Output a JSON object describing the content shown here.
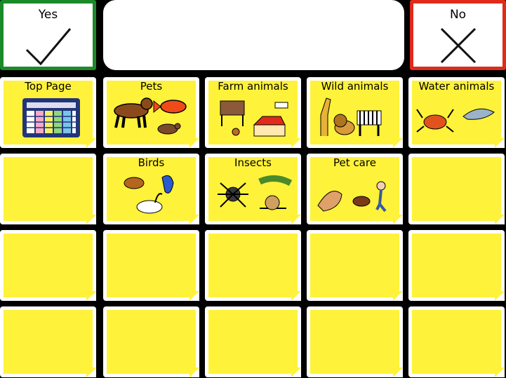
{
  "yes": {
    "label": "Yes",
    "icon": "check-icon",
    "border_color": "#1a8a2a"
  },
  "no": {
    "label": "No",
    "icon": "x-icon",
    "border_color": "#e02a1a"
  },
  "message_bar": {
    "text": ""
  },
  "grid": {
    "cell_color": "#fff23a",
    "cells": [
      {
        "label": "Top Page",
        "icon": "grid-board-icon"
      },
      {
        "label": "Pets",
        "icon": "pets-icon"
      },
      {
        "label": "Farm animals",
        "icon": "farm-icon"
      },
      {
        "label": "Wild animals",
        "icon": "wild-animals-icon"
      },
      {
        "label": "Water animals",
        "icon": "water-animals-icon"
      },
      {
        "label": "",
        "icon": ""
      },
      {
        "label": "Birds",
        "icon": "birds-icon"
      },
      {
        "label": "Insects",
        "icon": "insects-icon"
      },
      {
        "label": "Pet care",
        "icon": "pet-care-icon"
      },
      {
        "label": "",
        "icon": ""
      },
      {
        "label": "",
        "icon": ""
      },
      {
        "label": "",
        "icon": ""
      },
      {
        "label": "",
        "icon": ""
      },
      {
        "label": "",
        "icon": ""
      },
      {
        "label": "",
        "icon": ""
      },
      {
        "label": "",
        "icon": ""
      },
      {
        "label": "",
        "icon": ""
      },
      {
        "label": "",
        "icon": ""
      },
      {
        "label": "",
        "icon": ""
      },
      {
        "label": "",
        "icon": ""
      }
    ]
  }
}
